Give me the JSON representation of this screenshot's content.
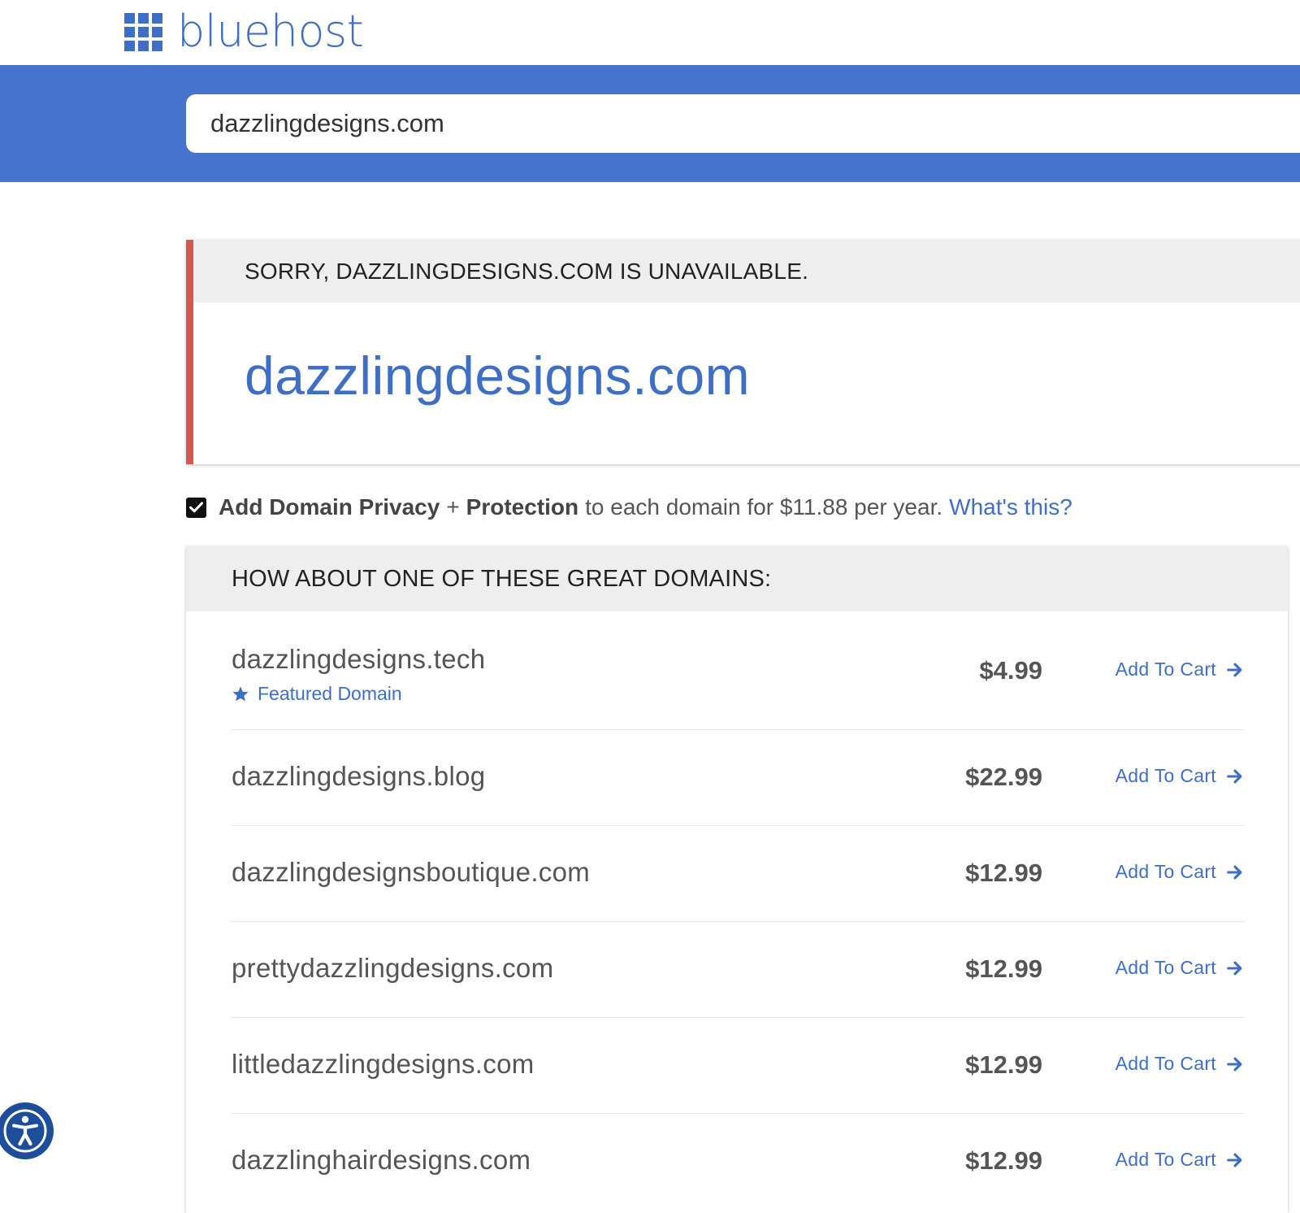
{
  "brand": {
    "name": "bluehost"
  },
  "search": {
    "value": "dazzlingdesigns.com"
  },
  "unavailable": {
    "message": "SORRY, DAZZLINGDESIGNS.COM IS UNAVAILABLE.",
    "domain": "dazzlingdesigns.com"
  },
  "privacy": {
    "checked": true,
    "bold1": "Add Domain Privacy",
    "plus": "+",
    "bold2": "Protection",
    "text": "to each domain for $11.88 per year.",
    "link": "What's this?"
  },
  "suggestions": {
    "title": "HOW ABOUT ONE OF THESE GREAT DOMAINS:",
    "add_label": "Add To Cart",
    "featured_label": "Featured Domain",
    "items": [
      {
        "domain": "dazzlingdesigns.tech",
        "price": "$4.99",
        "featured": true
      },
      {
        "domain": "dazzlingdesigns.blog",
        "price": "$22.99"
      },
      {
        "domain": "dazzlingdesignsboutique.com",
        "price": "$12.99"
      },
      {
        "domain": "prettydazzlingdesigns.com",
        "price": "$12.99"
      },
      {
        "domain": "littledazzlingdesigns.com",
        "price": "$12.99"
      },
      {
        "domain": "dazzlinghairdesigns.com",
        "price": "$12.99"
      }
    ]
  },
  "colors": {
    "brand_blue": "#3f6fc5",
    "band_blue": "#4673cc",
    "error_red": "#d4574f"
  },
  "icons": {
    "logo": "grid-logo-icon",
    "featured": "star-icon",
    "cart": "arrow-right-icon",
    "accessibility": "accessibility-icon",
    "checkbox": "checkmark-icon"
  }
}
